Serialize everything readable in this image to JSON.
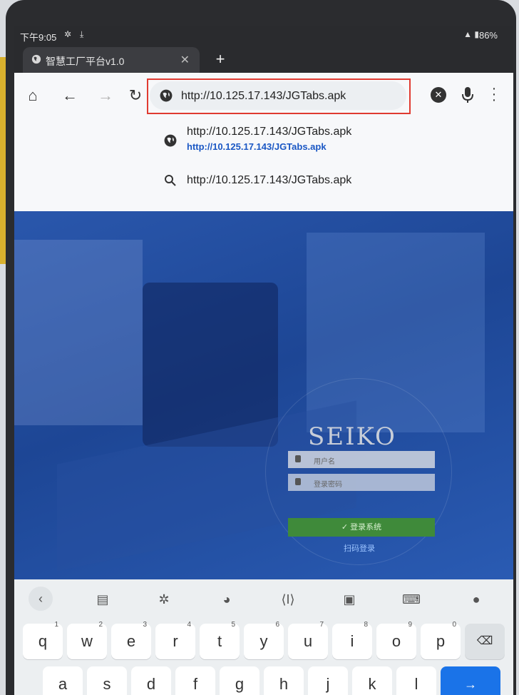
{
  "status_bar": {
    "time": "下午9:05",
    "battery": "86%"
  },
  "tabs": [
    {
      "title": "智慧工厂平台v1.0"
    }
  ],
  "new_tab_label": "+",
  "toolbar": {
    "address_value": "http://10.125.17.143/JGTabs.apk"
  },
  "suggestions": [
    {
      "type": "globe",
      "title": "http://10.125.17.143/JGTabs.apk",
      "url": "http://10.125.17.143/JGTabs.apk"
    },
    {
      "type": "search",
      "title": "http://10.125.17.143/JGTabs.apk"
    }
  ],
  "page": {
    "logo": "SEIKO",
    "username_placeholder": "用户名",
    "password_placeholder": "登录密码",
    "login_button": "✓ 登录系统",
    "scan_login": "扫码登录"
  },
  "keyboard": {
    "row1": [
      {
        "key": "q",
        "num": "1"
      },
      {
        "key": "w",
        "num": "2"
      },
      {
        "key": "e",
        "num": "3"
      },
      {
        "key": "r",
        "num": "4"
      },
      {
        "key": "t",
        "num": "5"
      },
      {
        "key": "y",
        "num": "6"
      },
      {
        "key": "u",
        "num": "7"
      },
      {
        "key": "i",
        "num": "8"
      },
      {
        "key": "o",
        "num": "9"
      },
      {
        "key": "p",
        "num": "0"
      }
    ],
    "row2": [
      "a",
      "s",
      "d",
      "f",
      "g",
      "h",
      "j",
      "k",
      "l"
    ],
    "toolbar_icons": [
      "back-icon",
      "clipboard-icon",
      "settings-icon",
      "palette-icon",
      "cursor-icon",
      "translate-icon",
      "keyboard-icon",
      "mic-icon"
    ]
  },
  "colors": {
    "highlight_border": "#e03b31",
    "link": "#1a57c4",
    "accent": "#1a73e8"
  }
}
